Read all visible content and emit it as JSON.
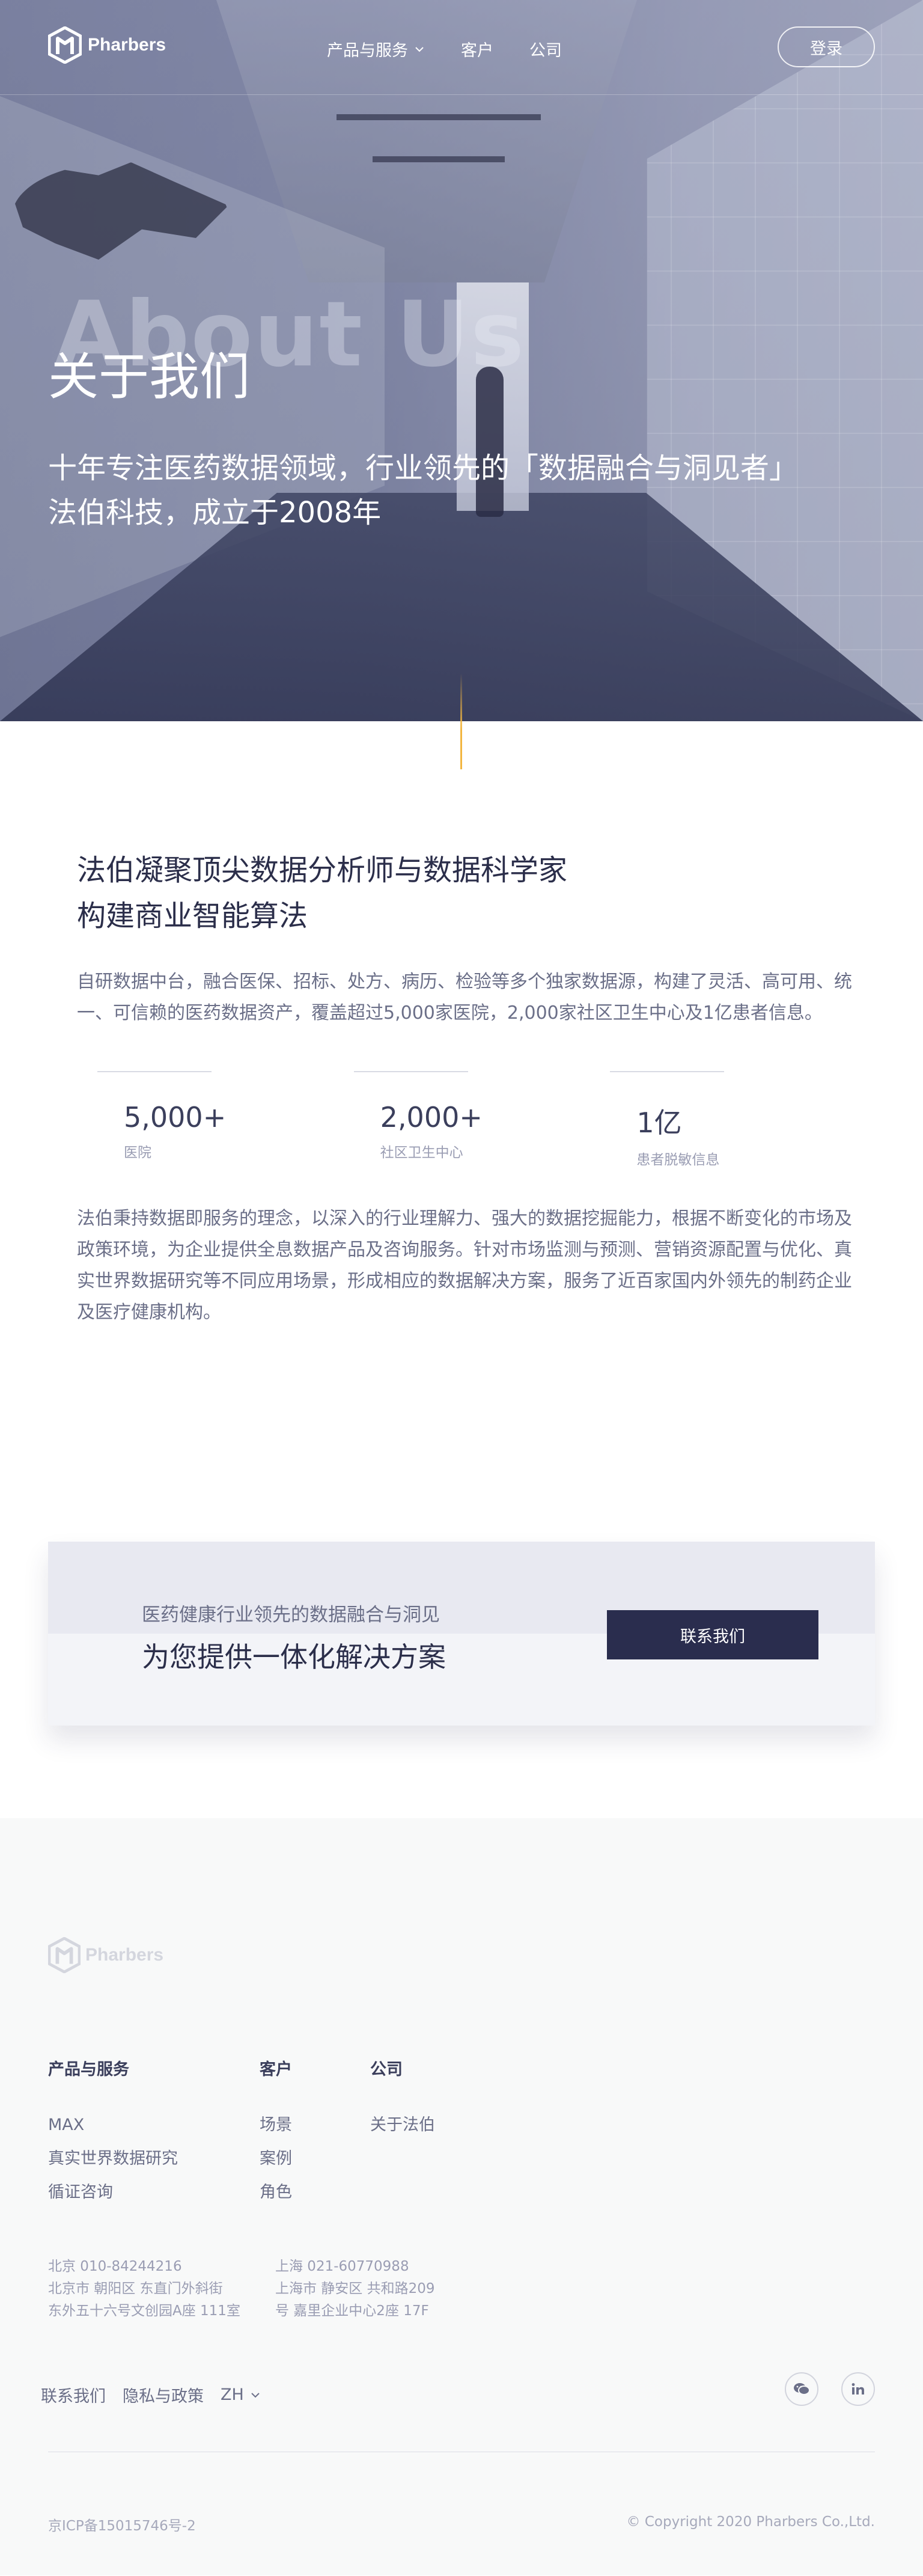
{
  "nav": {
    "brand": "Pharbers",
    "items": [
      {
        "label": "产品与服务",
        "has_dropdown": true
      },
      {
        "label": "客户",
        "has_dropdown": false
      },
      {
        "label": "公司",
        "has_dropdown": false
      }
    ],
    "login_label": "登录"
  },
  "hero": {
    "watermark": "About Us",
    "title": "关于我们",
    "subtitle_line1": "十年专注医药数据领域，行业领先的「数据融合与洞见者」",
    "subtitle_line2": "法伯科技，成立于2008年"
  },
  "about": {
    "heading_line1": "法伯凝聚顶尖数据分析师与数据科学家",
    "heading_line2": "构建商业智能算法",
    "paragraph1": "自研数据中台，融合医保、招标、处方、病历、检验等多个独家数据源，构建了灵活、高可用、统一、可信赖的医药数据资产，覆盖超过5,000家医院，2,000家社区卫生中心及1亿患者信息。",
    "stats": [
      {
        "value": "5,000+",
        "label": "医院"
      },
      {
        "value": "2,000+",
        "label": "社区卫生中心"
      },
      {
        "value": "1亿",
        "label": "患者脱敏信息"
      }
    ],
    "paragraph2": "法伯秉持数据即服务的理念，以深入的行业理解力、强大的数据挖掘能力，根据不断变化的市场及政策环境，为企业提供全息数据产品及咨询服务。针对市场监测与预测、营销资源配置与优化、真实世界数据研究等不同应用场景，形成相应的数据解决方案，服务了近百家国内外领先的制药企业及医疗健康机构。"
  },
  "cta": {
    "small_text": "医药健康行业领先的数据融合与洞见",
    "big_text": "为您提供一体化解决方案",
    "button_label": "联系我们"
  },
  "footer": {
    "brand": "Pharbers",
    "columns": [
      {
        "title": "产品与服务",
        "links": [
          "MAX",
          "真实世界数据研究",
          "循证咨询"
        ]
      },
      {
        "title": "客户",
        "links": [
          "场景",
          "案例",
          "角色"
        ]
      },
      {
        "title": "公司",
        "links": [
          "关于法伯"
        ]
      }
    ],
    "addresses": [
      {
        "line1": "北京  010-84244216",
        "line2": "北京市 朝阳区 东直门外斜街",
        "line3": "东外五十六号文创园A座 111室"
      },
      {
        "line1": "上海  021-60770988",
        "line2": "上海市 静安区 共和路209",
        "line3": "号 嘉里企业中心2座 17F"
      }
    ],
    "bottom_links": [
      "联系我们",
      "隐私与政策"
    ],
    "language": "ZH",
    "icp": "京ICP备15015746号-2",
    "copyright": "© Copyright 2020 Pharbers Co.,Ltd.",
    "icons": {
      "wechat": "wechat-icon",
      "linkedin": "linkedin-icon"
    }
  }
}
